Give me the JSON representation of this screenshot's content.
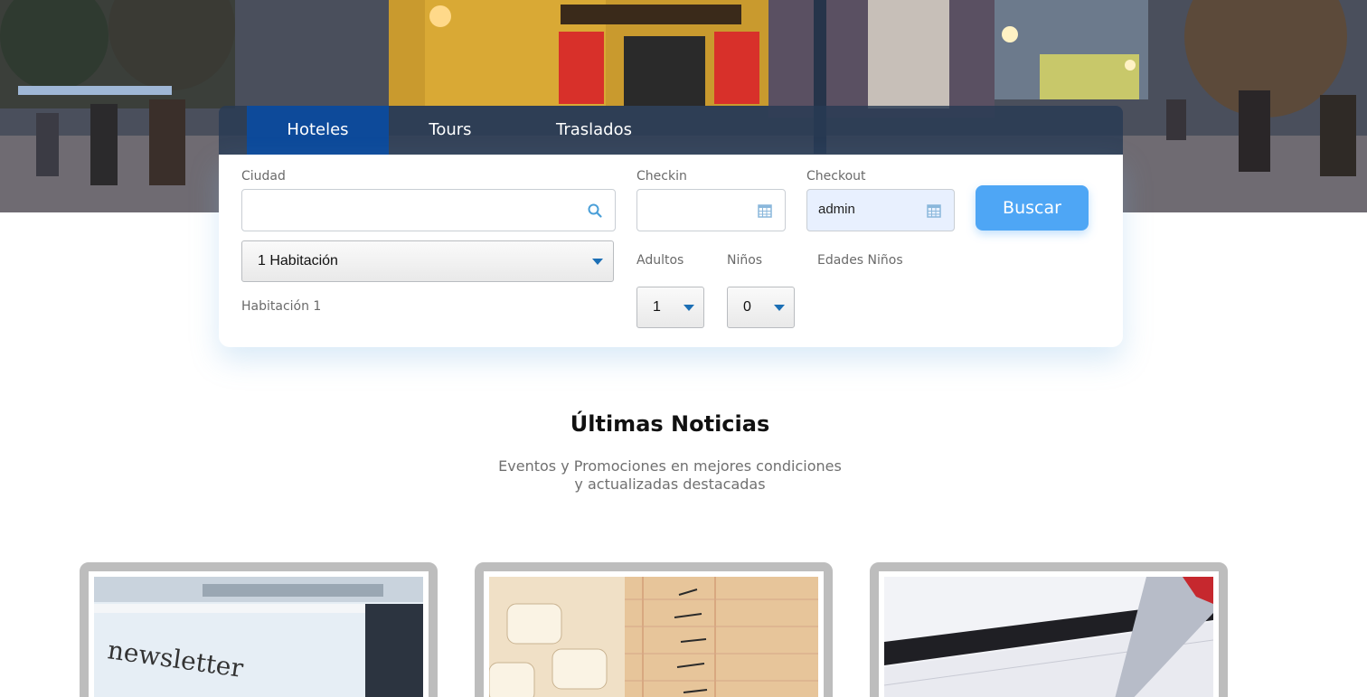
{
  "hero": {
    "image": "la-boca-caminito-street-photo"
  },
  "tabs": [
    {
      "label": "Hoteles",
      "active": true
    },
    {
      "label": "Tours",
      "active": false
    },
    {
      "label": "Traslados",
      "active": false
    }
  ],
  "search": {
    "ciudad": {
      "label": "Ciudad",
      "value": "",
      "icon": "search-icon"
    },
    "checkin": {
      "label": "Checkin",
      "value": "",
      "icon": "calendar-icon"
    },
    "checkout": {
      "label": "Checkout",
      "value": "admin",
      "icon": "calendar-icon"
    },
    "button_label": "Buscar",
    "rooms": {
      "selected": "1 Habitación"
    },
    "room_label": "Habitación 1",
    "adultos": {
      "label": "Adultos",
      "selected": "1"
    },
    "ninos": {
      "label": "Niños",
      "selected": "0"
    },
    "edades_label": "Edades Niños"
  },
  "news": {
    "title": "Últimas Noticias",
    "subtitle_line1": "Eventos y Promociones en mejores condiciones",
    "subtitle_line2": "y actualizadas destacadas",
    "cards": [
      {
        "image": "newsletter-typewriter-photo"
      },
      {
        "image": "calculator-ledger-photo"
      },
      {
        "image": "calendar-pen-photo"
      }
    ]
  },
  "colors": {
    "tab_active": "#0d4a9a",
    "button": "#4ea6f5",
    "caret": "#1c6fb5",
    "card_border": "#bdbdbd"
  }
}
